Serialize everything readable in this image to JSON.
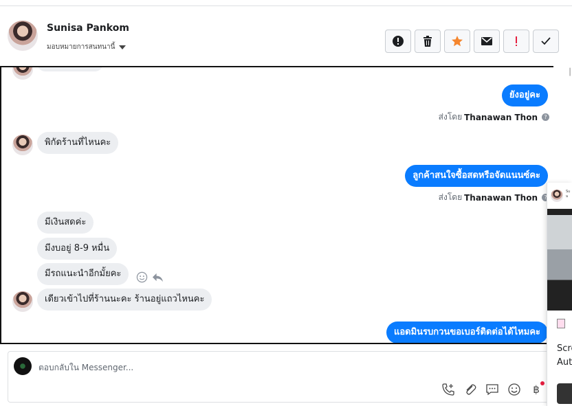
{
  "header": {
    "name": "Sunisa Pankom",
    "assign_label": "มอบหมายการสนทนานี้",
    "actions": [
      "mark-spam",
      "delete",
      "star",
      "mark-unread",
      "follow-up",
      "mark-done"
    ]
  },
  "messages": {
    "m1": "ยังอยู่คะ",
    "sent_prefix": "ส่งโดย",
    "sender": "Thanawan Thon",
    "m2": "พิกัดร้านที่ไหนคะ",
    "m3": "ลูกค้าสนใจซื้อสดหรือจัดแนนซ์คะ",
    "m4": "มีเงินสดค่ะ",
    "m5": "มีงบอยู่ 8-9 หมื่น",
    "m6": "มีรถแนะนำอีกมั้ยคะ",
    "m7": "เดียวเข้าไปที่ร้านนะคะ ร้านอยู่แถวไหนคะ",
    "m8": "แอดมินรบกวนขอเบอร์ติดต่อได้ไหมคะ"
  },
  "composer": {
    "placeholder": "ตอบกลับใน Messenger...",
    "currency": "฿"
  },
  "popup": {
    "line1": "Scre",
    "line2": "Aut"
  },
  "colors": {
    "outgoing": "#0a7cff",
    "incoming": "#eceef1",
    "star": "#f5862e",
    "followup": "#e41e3f"
  }
}
